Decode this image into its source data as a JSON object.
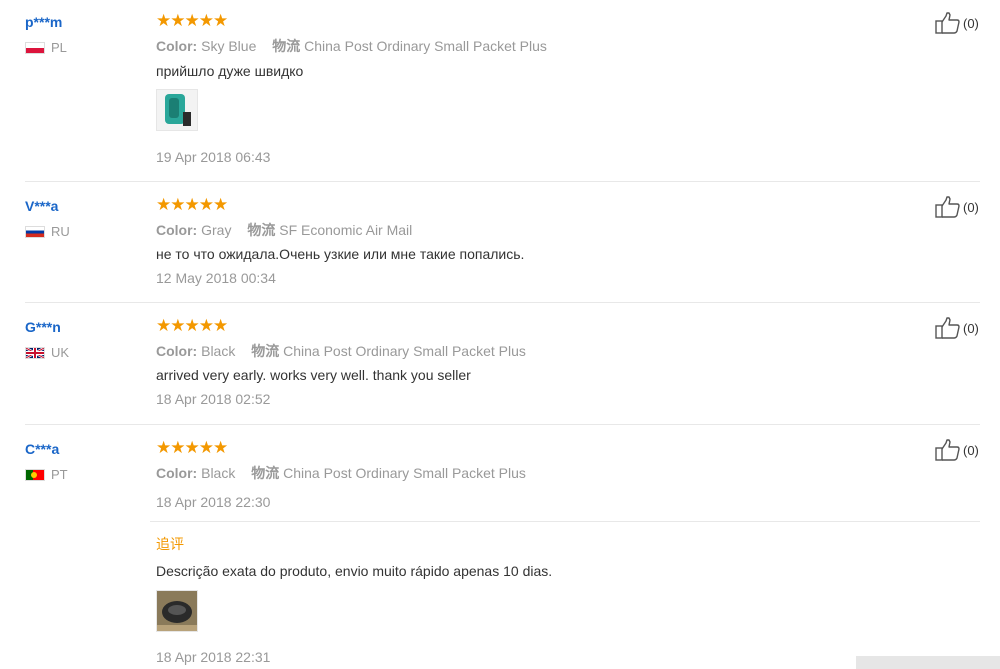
{
  "reviews": [
    {
      "user": "p***m",
      "country": "PL",
      "stars": "★★★★★",
      "color_label": "Color:",
      "color": "Sky Blue",
      "shipping_label": "物流",
      "shipping": "China Post Ordinary Small Packet Plus",
      "text": "прийшло дуже швидко",
      "date": "19 Apr 2018 06:43",
      "likes": "(0)"
    },
    {
      "user": "V***a",
      "country": "RU",
      "stars": "★★★★★",
      "color_label": "Color:",
      "color": "Gray",
      "shipping_label": "物流",
      "shipping": "SF Economic Air Mail",
      "text": "не то что ожидала.Очень узкие или мне такие попались.",
      "date": "12 May 2018 00:34",
      "likes": "(0)"
    },
    {
      "user": "G***n",
      "country": "UK",
      "stars": "★★★★★",
      "color_label": "Color:",
      "color": "Black",
      "shipping_label": "物流",
      "shipping": "China Post Ordinary Small Packet Plus",
      "text": "arrived very early. works very well. thank you seller",
      "date": "18 Apr 2018 02:52",
      "likes": "(0)"
    },
    {
      "user": "C***a",
      "country": "PT",
      "stars": "★★★★★",
      "color_label": "Color:",
      "color": "Black",
      "shipping_label": "物流",
      "shipping": "China Post Ordinary Small Packet Plus",
      "date": "18 Apr 2018 22:30",
      "likes": "(0)",
      "followup": {
        "label": "追评",
        "text": "Descrição exata do produto, envio muito rápido apenas 10 dias.",
        "date": "18 Apr 2018 22:31"
      }
    }
  ],
  "colors": {
    "username": "#1a66c8",
    "stars": "#f39800",
    "muted": "#999999",
    "text": "#333333"
  },
  "icons": {
    "like": "thumbs-up-icon"
  }
}
